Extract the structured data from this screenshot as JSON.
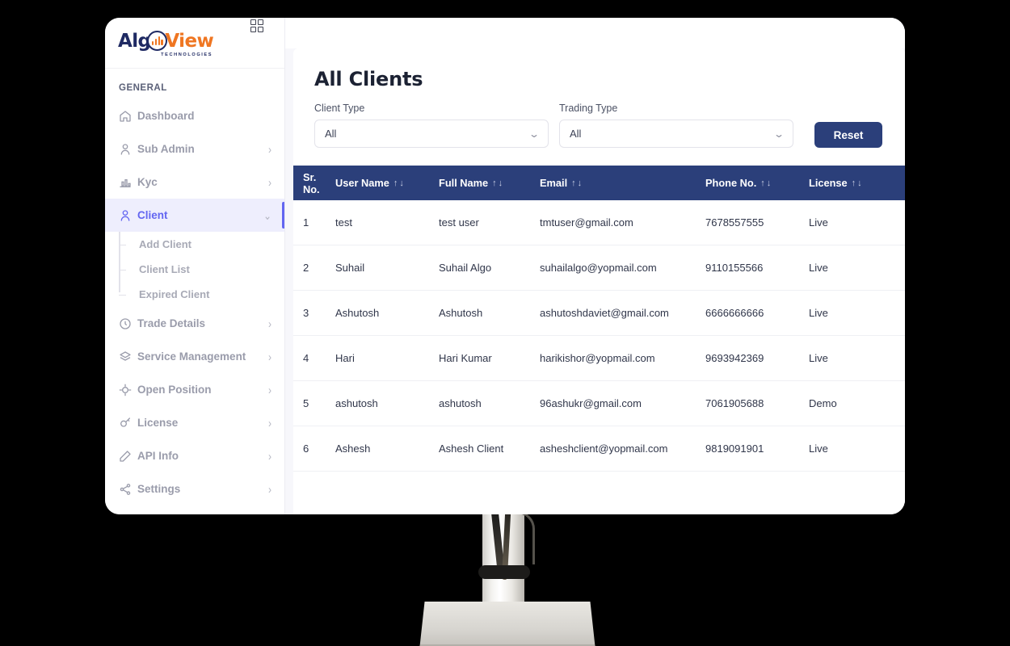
{
  "sidebar": {
    "logo": {
      "part1": "Alg",
      "part2": "View",
      "tagline": "TECHNOLOGIES"
    },
    "section_label": "GENERAL",
    "grid_icon": "grid-2x2-icon",
    "items": [
      {
        "label": "Dashboard",
        "icon": "home-icon",
        "chevron": "",
        "active": false
      },
      {
        "label": "Sub Admin",
        "icon": "user-icon",
        "chevron": "›",
        "active": false
      },
      {
        "label": "Kyc",
        "icon": "chart-icon",
        "chevron": "›",
        "active": false
      },
      {
        "label": "Client",
        "icon": "user-icon",
        "chevron": "⌄",
        "active": true
      },
      {
        "label": "Trade Details",
        "icon": "clock-icon",
        "chevron": "›",
        "active": false
      },
      {
        "label": "Service Management",
        "icon": "layers-icon",
        "chevron": "›",
        "active": false
      },
      {
        "label": "Open Position",
        "icon": "position-icon",
        "chevron": "›",
        "active": false
      },
      {
        "label": "License",
        "icon": "key-icon",
        "chevron": "›",
        "active": false
      },
      {
        "label": "API Info",
        "icon": "pen-icon",
        "chevron": "›",
        "active": false
      },
      {
        "label": "Settings",
        "icon": "settings-icon",
        "chevron": "›",
        "active": false
      }
    ],
    "sub_items": [
      {
        "label": "Add Client"
      },
      {
        "label": "Client List"
      },
      {
        "label": "Expired Client"
      }
    ]
  },
  "main": {
    "title": "All Clients",
    "filters": {
      "client_type": {
        "label": "Client Type",
        "value": "All",
        "chevron": "⌄"
      },
      "trading_type": {
        "label": "Trading Type",
        "value": "All",
        "chevron": "⌄"
      },
      "reset_label": "Reset"
    },
    "table": {
      "sort_asc": "↑",
      "sort_desc": "↓",
      "columns": [
        {
          "label": "Sr. No.",
          "sortable": false
        },
        {
          "label": "User Name",
          "sortable": true
        },
        {
          "label": "Full Name",
          "sortable": true
        },
        {
          "label": "Email",
          "sortable": true
        },
        {
          "label": "Phone No.",
          "sortable": true
        },
        {
          "label": "License",
          "sortable": true
        }
      ],
      "rows": [
        {
          "sr": "1",
          "user": "test",
          "full": "test user",
          "email": "tmtuser@gmail.com",
          "phone": "7678557555",
          "license": "Live"
        },
        {
          "sr": "2",
          "user": "Suhail",
          "full": "Suhail Algo",
          "email": "suhailalgo@yopmail.com",
          "phone": "9110155566",
          "license": "Live"
        },
        {
          "sr": "3",
          "user": "Ashutosh",
          "full": "Ashutosh",
          "email": "ashutoshdaviet@gmail.com",
          "phone": "6666666666",
          "license": "Live"
        },
        {
          "sr": "4",
          "user": "Hari",
          "full": "Hari Kumar",
          "email": "harikishor@yopmail.com",
          "phone": "9693942369",
          "license": "Live"
        },
        {
          "sr": "5",
          "user": "ashutosh",
          "full": "ashutosh",
          "email": "96ashukr@gmail.com",
          "phone": "7061905688",
          "license": "Demo"
        },
        {
          "sr": "6",
          "user": "Ashesh",
          "full": "Ashesh Client",
          "email": "asheshclient@yopmail.com",
          "phone": "9819091901",
          "license": "Live"
        }
      ]
    }
  },
  "colors": {
    "accent_purple": "#6366f1",
    "header_navy": "#2b3f7a",
    "brand_navy": "#1f2a63",
    "brand_orange": "#ef7622"
  }
}
